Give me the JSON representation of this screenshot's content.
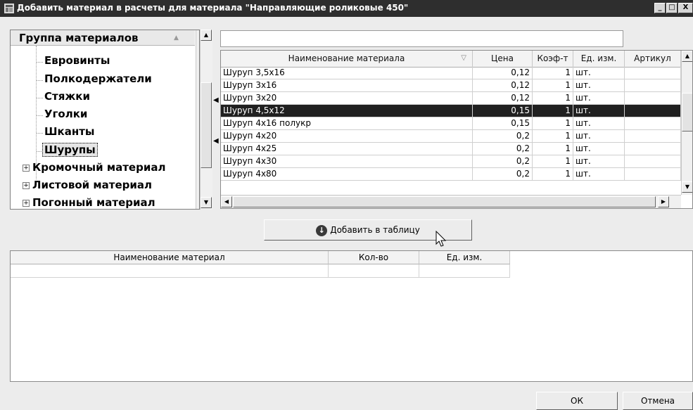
{
  "window": {
    "title": "Добавить материал в расчеты для материала \"Направляющие роликовые 450\"",
    "controls": [
      "_",
      "□",
      "X"
    ]
  },
  "tree": {
    "header": "Группа материалов",
    "children": [
      "Евровинты",
      "Полкодержатели",
      "Стяжки",
      "Уголки",
      "Шканты",
      "Шурупы"
    ],
    "selected": "Шурупы",
    "groups": [
      "Кромочный материал",
      "Листовой материал",
      "Погонный материал"
    ]
  },
  "search": {
    "value": ""
  },
  "materials": {
    "columns": [
      "Наименование материала",
      "Цена",
      "Коэф-т",
      "Ед. изм.",
      "Артикул"
    ],
    "rows": [
      {
        "name": "Шуруп 3,5х16",
        "price": "0,12",
        "coef": "1",
        "unit": "шт.",
        "article": ""
      },
      {
        "name": "Шуруп 3х16",
        "price": "0,12",
        "coef": "1",
        "unit": "шт.",
        "article": ""
      },
      {
        "name": "Шуруп 3х20",
        "price": "0,12",
        "coef": "1",
        "unit": "шт.",
        "article": ""
      },
      {
        "name": "Шуруп 4,5х12",
        "price": "0,15",
        "coef": "1",
        "unit": "шт.",
        "article": ""
      },
      {
        "name": "Шуруп 4х16 полукр",
        "price": "0,15",
        "coef": "1",
        "unit": "шт.",
        "article": ""
      },
      {
        "name": "Шуруп 4х20",
        "price": "0,2",
        "coef": "1",
        "unit": "шт.",
        "article": ""
      },
      {
        "name": "Шуруп 4х25",
        "price": "0,2",
        "coef": "1",
        "unit": "шт.",
        "article": ""
      },
      {
        "name": "Шуруп 4х30",
        "price": "0,2",
        "coef": "1",
        "unit": "шт.",
        "article": ""
      },
      {
        "name": "Шуруп 4х80",
        "price": "0,2",
        "coef": "1",
        "unit": "шт.",
        "article": ""
      }
    ],
    "selected_row": 3
  },
  "actions": {
    "add_to_table": "Добавить в таблицу"
  },
  "result_table": {
    "columns": [
      "Наименование материал",
      "Кол-во",
      "Ед. изм."
    ]
  },
  "footer": {
    "ok": "ОК",
    "cancel": "Отмена"
  }
}
